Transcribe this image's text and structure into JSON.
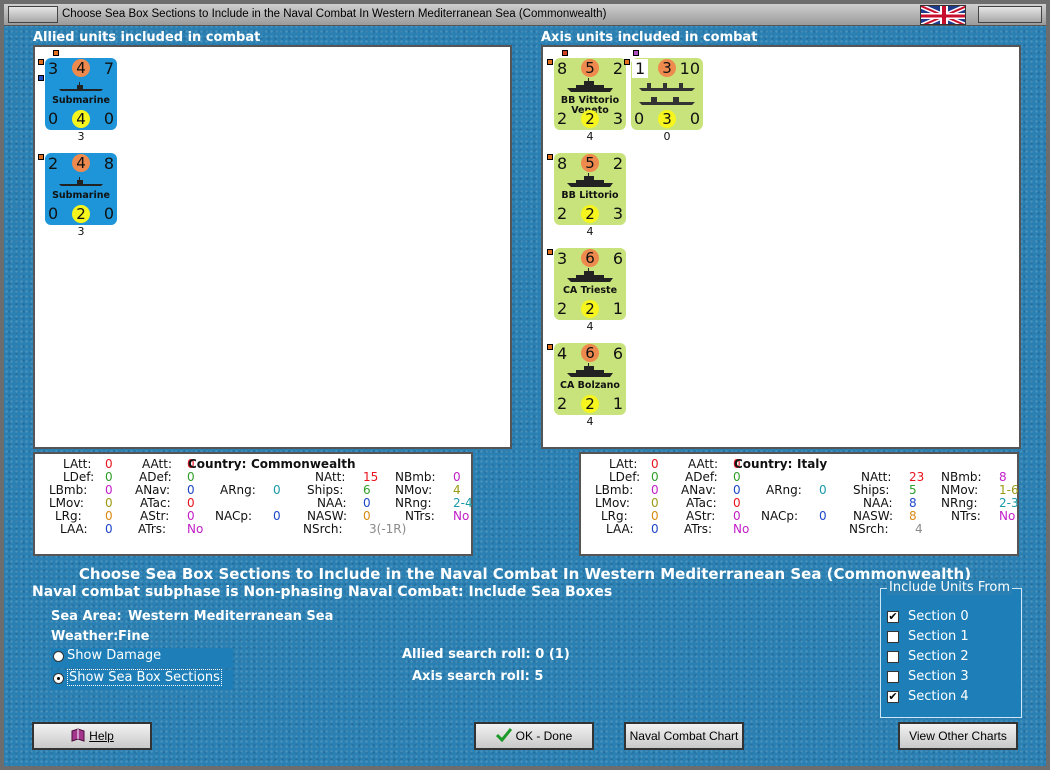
{
  "window": {
    "title": "Choose Sea Box Sections to Include in the Naval Combat In Western Mediterranean Sea (Commonwealth)"
  },
  "allied": {
    "label": "Allied units included in combat",
    "units": [
      {
        "tl": "3",
        "tc": "4",
        "tr": "7",
        "name": "Submarine",
        "bl": "0",
        "bc": "4",
        "br": "0",
        "below": "3"
      },
      {
        "tl": "2",
        "tc": "4",
        "tr": "8",
        "name": "Submarine",
        "bl": "0",
        "bc": "2",
        "br": "0",
        "below": "3"
      }
    ]
  },
  "axis": {
    "label": "Axis units included in combat",
    "units": [
      {
        "tl": "8",
        "tc": "5",
        "tr": "2",
        "name": "BB Vittorio Veneto",
        "bl": "2",
        "bc": "2",
        "br": "3",
        "below": "4"
      },
      {
        "tl": "1",
        "tc": "3",
        "tr": "10",
        "name": "",
        "bl": "0",
        "bc": "3",
        "br": "0",
        "below": "0"
      },
      {
        "tl": "8",
        "tc": "5",
        "tr": "2",
        "name": "BB Littorio",
        "bl": "2",
        "bc": "2",
        "br": "3",
        "below": "4"
      },
      {
        "tl": "3",
        "tc": "6",
        "tr": "6",
        "name": "CA Trieste",
        "bl": "2",
        "bc": "2",
        "br": "1",
        "below": "4"
      },
      {
        "tl": "4",
        "tc": "6",
        "tr": "6",
        "name": "CA Bolzano",
        "bl": "2",
        "bc": "2",
        "br": "1",
        "below": "4"
      }
    ]
  },
  "stat_labels": {
    "latt": "LAtt:",
    "ldef": "LDef:",
    "lbmb": "LBmb:",
    "lmov": "LMov:",
    "lrg": "LRg:",
    "laa": "LAA:",
    "aatt": "AAtt:",
    "adef": "ADef:",
    "anav": "ANav:",
    "atac": "ATac:",
    "astr": "AStr:",
    "atrs": "ATrs:",
    "country": "Country:",
    "arng": "ARng:",
    "nacp": "NACp:",
    "natt": "NAtt:",
    "ships": "Ships:",
    "naa": "NAA:",
    "nasw": "NASW:",
    "nsrch": "NSrch:",
    "nbmb": "NBmb:",
    "nmov": "NMov:",
    "nrng": "NRng:",
    "ntrs": "NTrs:"
  },
  "allied_stats": {
    "latt": "0",
    "ldef": "0",
    "lbmb": "0",
    "lmov": "0",
    "lrg": "0",
    "laa": "0",
    "aatt": "0",
    "adef": "0",
    "anav": "0",
    "atac": "0",
    "astr": "0",
    "atrs": "No",
    "country": "Commonwealth",
    "arng": "0",
    "nacp": "0",
    "natt": "15",
    "ships": "6",
    "naa": "0",
    "nasw": "0",
    "nsrch": "3(-1R)",
    "nbmb": "0",
    "nmov": "4",
    "nrng": "2-4",
    "ntrs": "No"
  },
  "axis_stats": {
    "latt": "0",
    "ldef": "0",
    "lbmb": "0",
    "lmov": "0",
    "lrg": "0",
    "laa": "0",
    "aatt": "0",
    "adef": "0",
    "anav": "0",
    "atac": "0",
    "astr": "0",
    "atrs": "No",
    "country": "Italy",
    "arng": "0",
    "nacp": "0",
    "natt": "23",
    "ships": "5",
    "naa": "8",
    "nasw": "8",
    "nsrch": "4",
    "nbmb": "8",
    "nmov": "1-6",
    "nrng": "2-3",
    "ntrs": "No"
  },
  "info": {
    "heading": "Choose Sea Box Sections to Include in the Naval Combat In Western Mediterranean Sea (Commonwealth)",
    "subphase": "Naval combat subphase is Non-phasing Naval Combat: Include Sea Boxes",
    "sea_area_label": "Sea Area:",
    "sea_area": "Western Mediterranean Sea",
    "weather_label": "Weather:",
    "weather": "Fine",
    "allied_roll": "Allied search roll: 0 (1)",
    "axis_roll": "Axis search roll: 5"
  },
  "view_options": [
    {
      "label": "Show Damage",
      "selected": false
    },
    {
      "label": "Show Sea Box Sections",
      "selected": true
    }
  ],
  "include": {
    "legend": "Include Units From",
    "sections": [
      {
        "label": "Section 0",
        "checked": true
      },
      {
        "label": "Section 1",
        "checked": false
      },
      {
        "label": "Section 2",
        "checked": false
      },
      {
        "label": "Section 3",
        "checked": false
      },
      {
        "label": "Section 4",
        "checked": true
      }
    ]
  },
  "buttons": {
    "help": "Help",
    "ok": "OK - Done",
    "naval_chart": "Naval Combat Chart",
    "other_charts": "View Other Charts"
  },
  "colors": {
    "red": "#e8141e",
    "green": "#2f9e2a",
    "blue": "#1e46c8",
    "orange": "#d98a12",
    "magenta": "#c21ec8",
    "teal": "#1a9aa8",
    "olive": "#9a9a16",
    "gray": "#8a8a8a",
    "unit_blue": "#1e95d8",
    "unit_green": "#c8e37c"
  }
}
